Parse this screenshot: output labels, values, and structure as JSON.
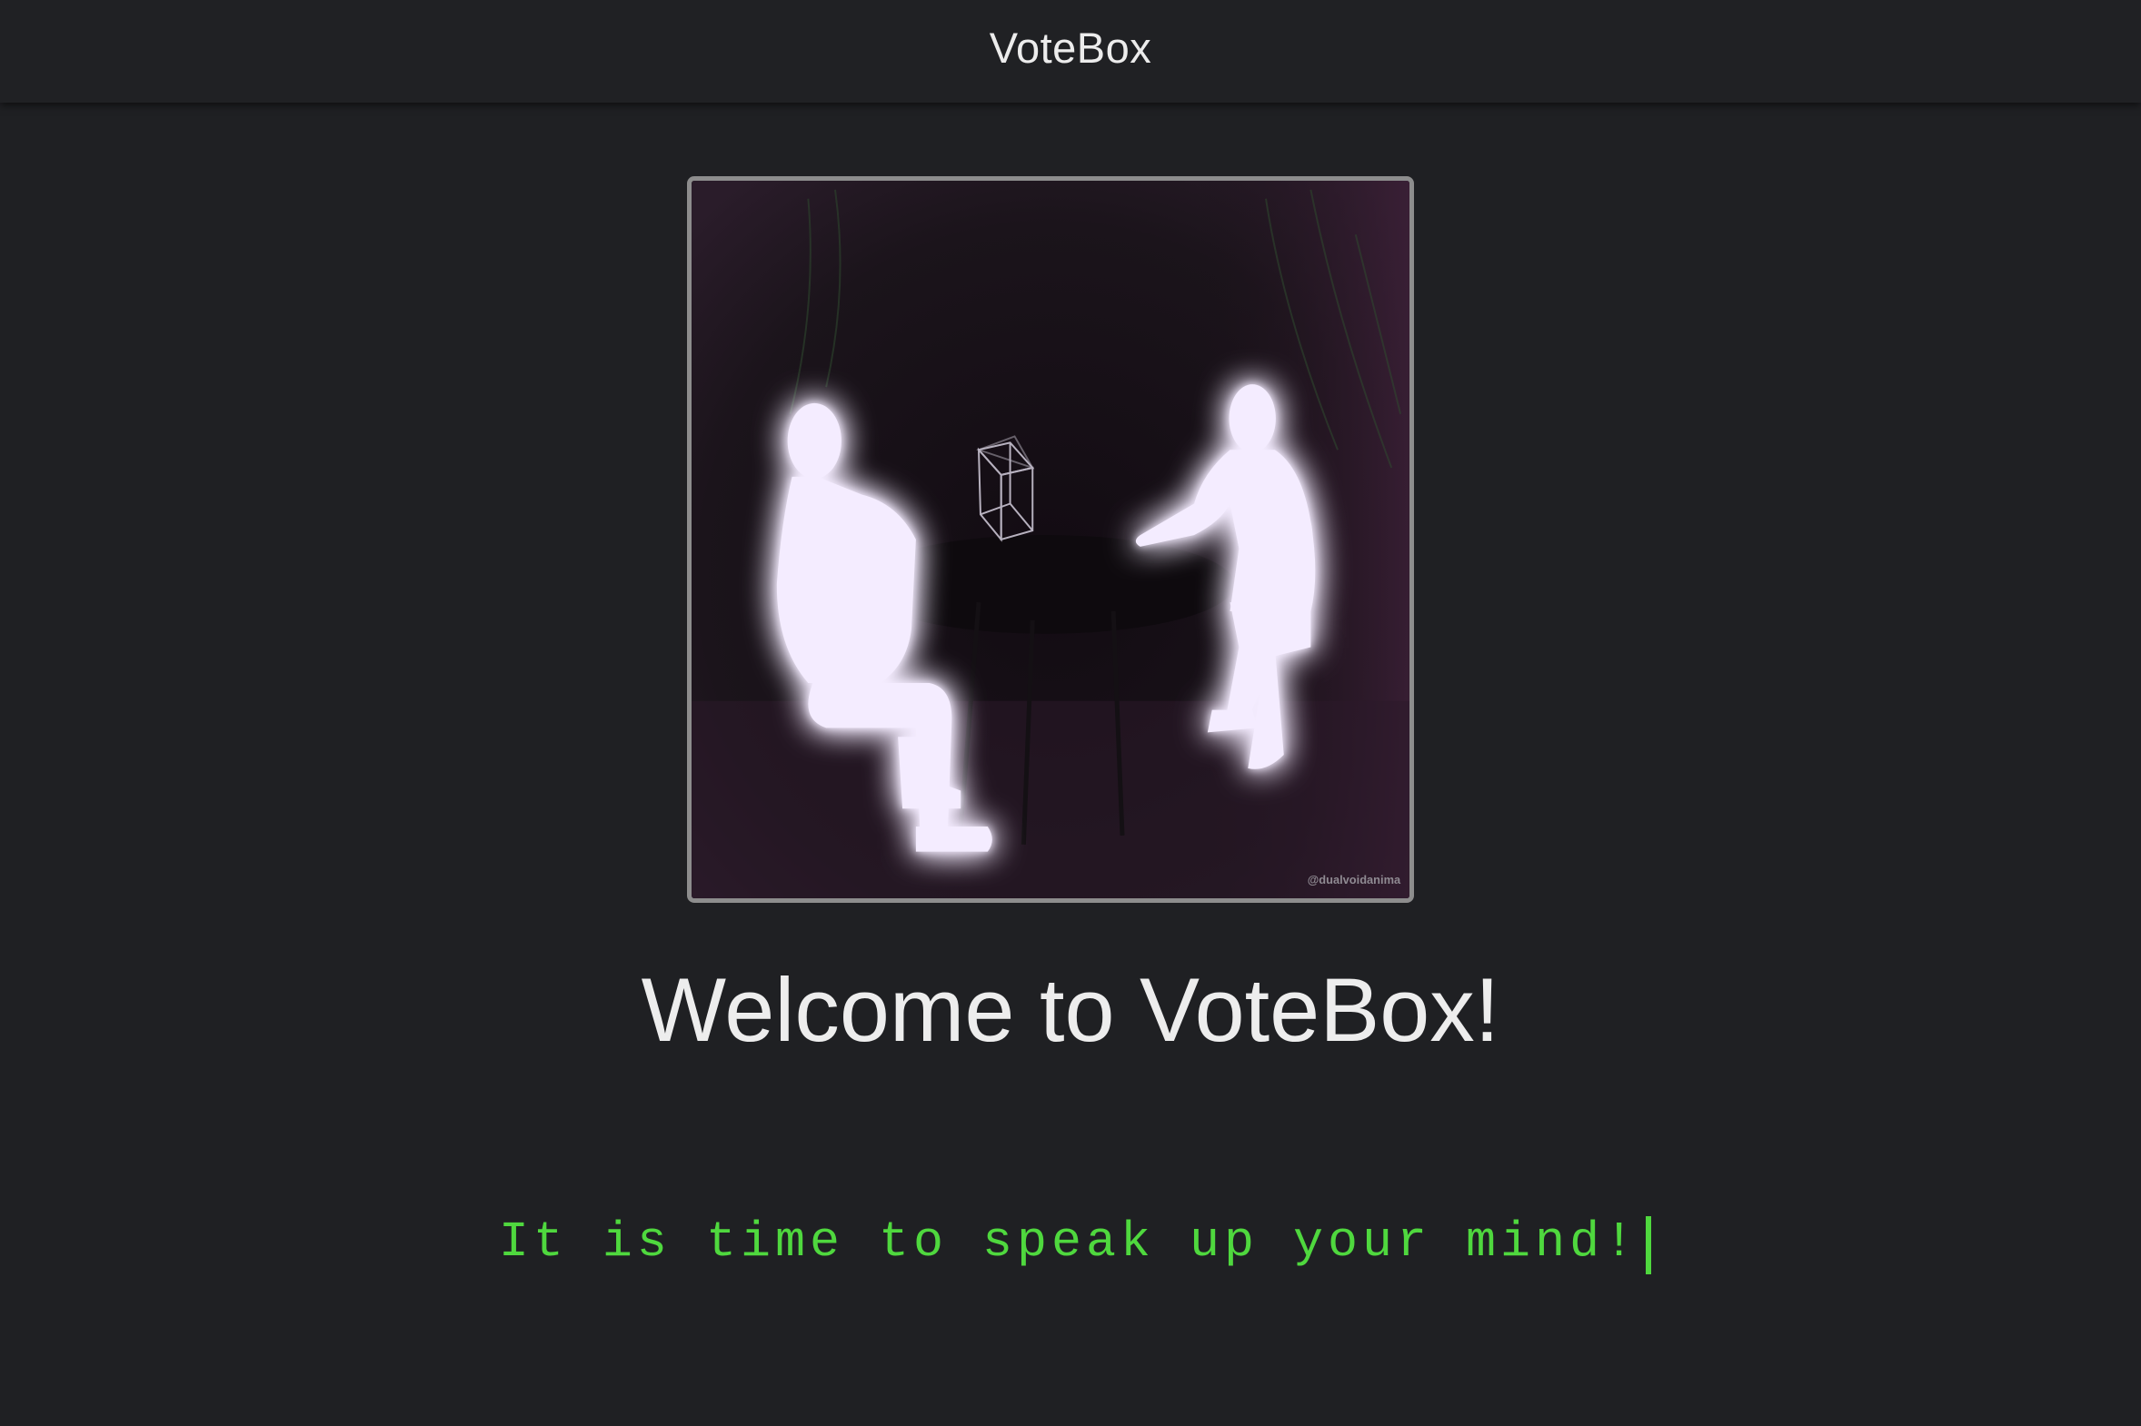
{
  "header": {
    "title": "VoteBox"
  },
  "hero": {
    "image_description": "two-glowing-figures-at-table",
    "watermark": "@dualvoidanima"
  },
  "main": {
    "heading": "Welcome to VoteBox!",
    "tagline": "It is time to speak up your mind!"
  },
  "colors": {
    "background": "#1f2023",
    "header_background": "#202124",
    "tagline_green": "#4fd83e",
    "figure_glow": "#b07cff"
  }
}
